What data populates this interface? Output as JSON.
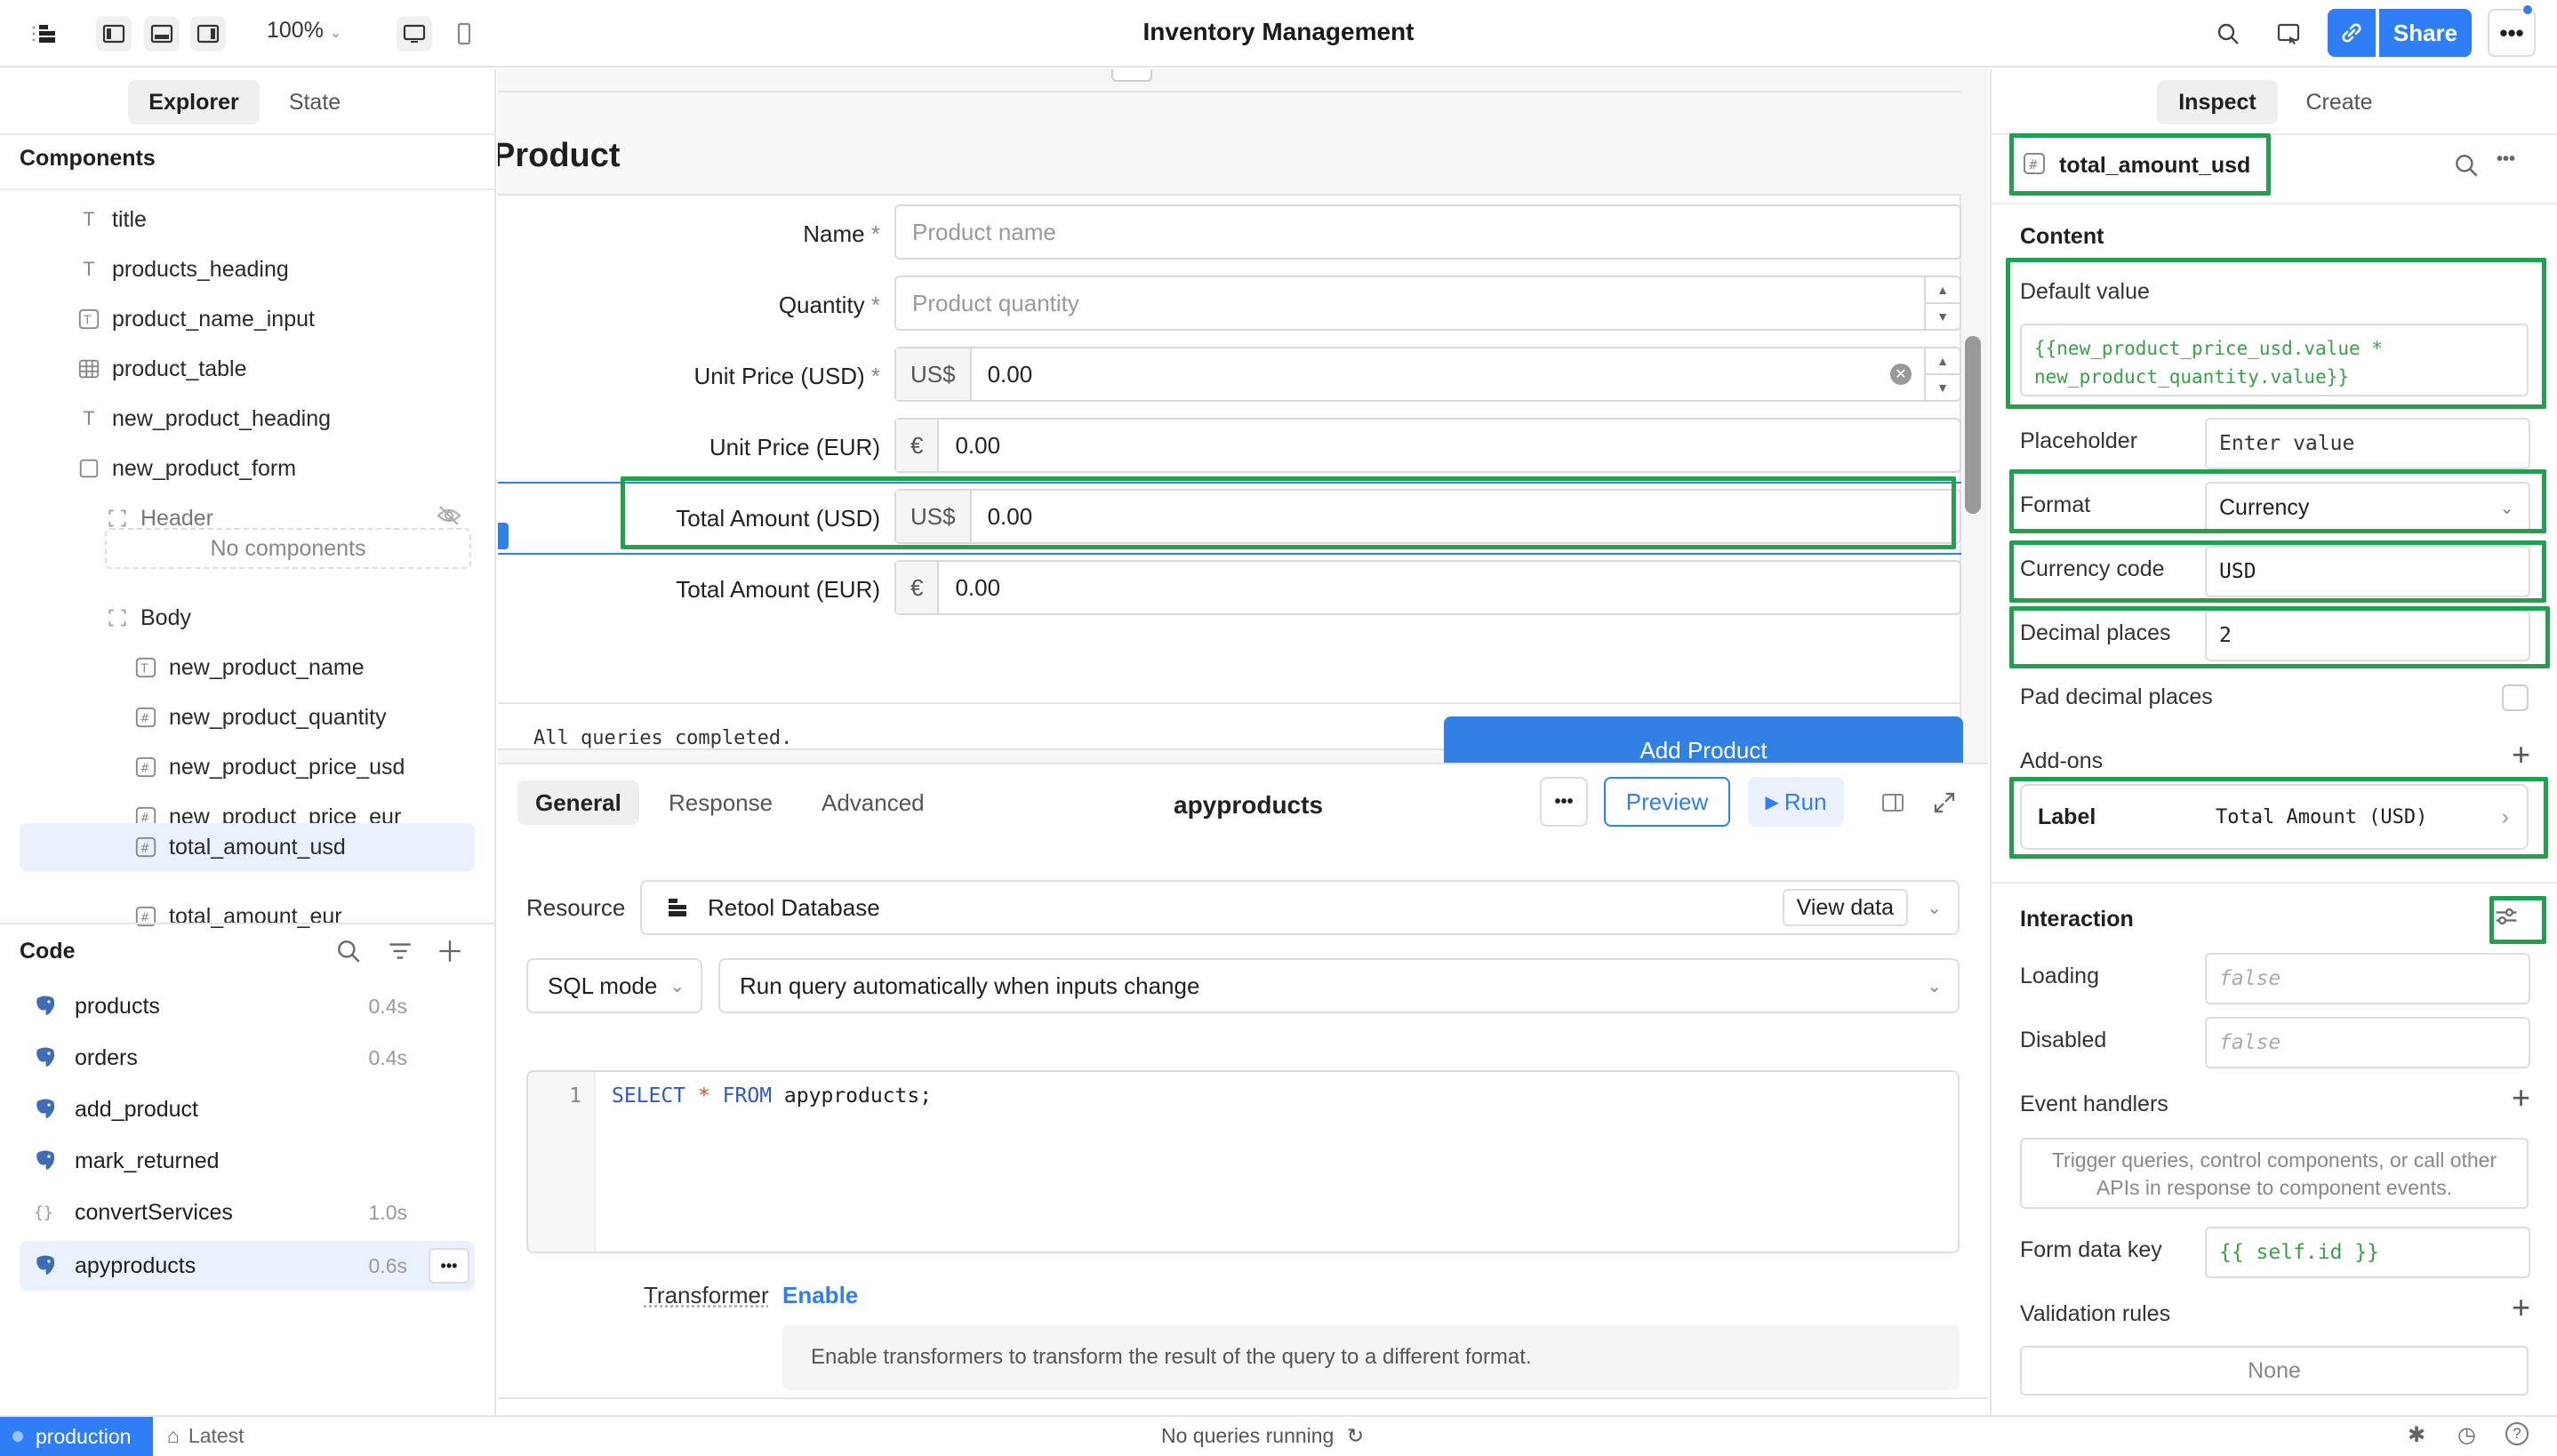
{
  "header": {
    "zoom": "100%",
    "title": "Inventory Management",
    "share_label": "Share"
  },
  "left": {
    "tabs": [
      "Explorer",
      "State"
    ],
    "components_title": "Components",
    "tree": [
      {
        "label": "title",
        "icon": "text-icon"
      },
      {
        "label": "products_heading",
        "icon": "text-icon"
      },
      {
        "label": "product_name_input",
        "icon": "text-input-icon"
      },
      {
        "label": "product_table",
        "icon": "table-icon"
      },
      {
        "label": "new_product_heading",
        "icon": "text-icon"
      },
      {
        "label": "new_product_form",
        "icon": "form-icon"
      },
      {
        "label": "Header",
        "icon": "frame-icon"
      },
      {
        "label": "Body",
        "icon": "frame-icon"
      },
      {
        "label": "new_product_name",
        "icon": "text-input-icon"
      },
      {
        "label": "new_product_quantity",
        "icon": "number-input-icon"
      },
      {
        "label": "new_product_price_usd",
        "icon": "number-input-icon"
      },
      {
        "label": "new_product_price_eur",
        "icon": "number-input-icon"
      },
      {
        "label": "total_amount_usd",
        "icon": "number-input-icon"
      },
      {
        "label": "total_amount_eur",
        "icon": "number-input-icon"
      }
    ],
    "no_components": "No components",
    "code_title": "Code",
    "queries": [
      {
        "name": "products",
        "time": "0.4s"
      },
      {
        "name": "orders",
        "time": "0.4s"
      },
      {
        "name": "add_product",
        "time": ""
      },
      {
        "name": "mark_returned",
        "time": ""
      },
      {
        "name": "convertServices",
        "time": "1.0s"
      },
      {
        "name": "apyproducts",
        "time": "0.6s"
      }
    ]
  },
  "form": {
    "title": "Product",
    "rows": [
      {
        "label": "Name",
        "required": "*",
        "placeholder": "Product name"
      },
      {
        "label": "Quantity",
        "required": "*",
        "placeholder": "Product quantity"
      },
      {
        "label": "Unit Price (USD)",
        "required": "*",
        "prefix": "US$",
        "value": "0.00"
      },
      {
        "label": "Unit Price (EUR)",
        "prefix": "€",
        "value": "0.00"
      },
      {
        "label": "Total Amount (USD)",
        "prefix": "US$",
        "value": "0.00"
      },
      {
        "label": "Total Amount (EUR)",
        "prefix": "€",
        "value": "0.00"
      }
    ],
    "status": "All queries completed.",
    "add_button": "Add Product"
  },
  "query": {
    "tabs": [
      "General",
      "Response",
      "Advanced"
    ],
    "name": "apyproducts",
    "preview": "Preview",
    "run": "Run",
    "resource_label": "Resource",
    "resource_value": "Retool Database",
    "view_data": "View data",
    "mode": "SQL mode",
    "trigger": "Run query automatically when inputs change",
    "line_no": "1",
    "sql": {
      "kw1": "SELECT",
      "star": "*",
      "kw2": "FROM",
      "table": "apyproducts;"
    },
    "transformer_label": "Transformer",
    "transformer_enable": "Enable",
    "transformer_hint": "Enable transformers to transform the result of the query to a different format."
  },
  "inspector": {
    "tabs": [
      "Inspect",
      "Create"
    ],
    "component_name": "total_amount_usd",
    "content_title": "Content",
    "default_value_label": "Default value",
    "default_value_line1": "{{new_product_price_usd.value *",
    "default_value_line2": "new_product_quantity.value}}",
    "placeholder_label": "Placeholder",
    "placeholder_value": "Enter value",
    "format_label": "Format",
    "format_value": "Currency",
    "currency_label": "Currency code",
    "currency_value": "USD",
    "decimal_label": "Decimal places",
    "decimal_value": "2",
    "pad_label": "Pad decimal places",
    "addons_title": "Add-ons",
    "addon_label_key": "Label",
    "addon_label_value": "Total Amount (USD)",
    "interaction_title": "Interaction",
    "loading_label": "Loading",
    "loading_value": "false",
    "disabled_label": "Disabled",
    "disabled_value": "false",
    "event_label": "Event handlers",
    "event_hint": "Trigger queries, control components, or call other APIs in response to component events.",
    "formkey_label": "Form data key",
    "formkey_value": "{{ self.id }}",
    "validation_label": "Validation rules",
    "validation_value": "None"
  },
  "statusbar": {
    "env": "production",
    "version": "Latest",
    "running": "No queries running"
  },
  "colors": {
    "accent": "#2f7ef5",
    "highlight": "#22a050"
  }
}
